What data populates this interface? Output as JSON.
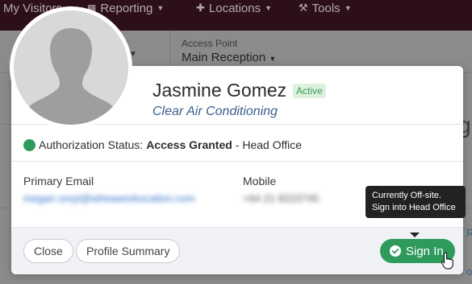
{
  "nav": {
    "items": [
      {
        "label": "My Visitors",
        "icon": ""
      },
      {
        "label": "Reporting",
        "icon": "bar-chart-icon"
      },
      {
        "label": "Locations",
        "icon": "map-marker-icon"
      },
      {
        "label": "Tools",
        "icon": "wrench-icon"
      }
    ]
  },
  "background": {
    "access_point_label": "Access Point",
    "access_point_value": "Main Reception",
    "partial_right_text": "g",
    "partial_link_1": "R",
    "partial_link_2": "o"
  },
  "visitor": {
    "name": "Jasmine Gomez",
    "status": "Active",
    "company": "Clear Air Conditioning",
    "auth_prefix": "Authorization Status:",
    "auth_status": "Access Granted",
    "auth_location": "- Head Office",
    "email_label": "Primary Email",
    "email_value": "megan.smyt@wheaworkocation.com",
    "mobile_label": "Mobile",
    "mobile_value": "+64 21 8223745"
  },
  "actions": {
    "close_label": "Close",
    "summary_label": "Profile Summary",
    "signin_label": "Sign In"
  },
  "tooltip": {
    "text": "Currently Off-site. Sign into Head Office"
  },
  "colors": {
    "accent_green": "#2e9a5c",
    "link_blue": "#3a5e8c",
    "nav_bg": "#2d0f1b"
  }
}
